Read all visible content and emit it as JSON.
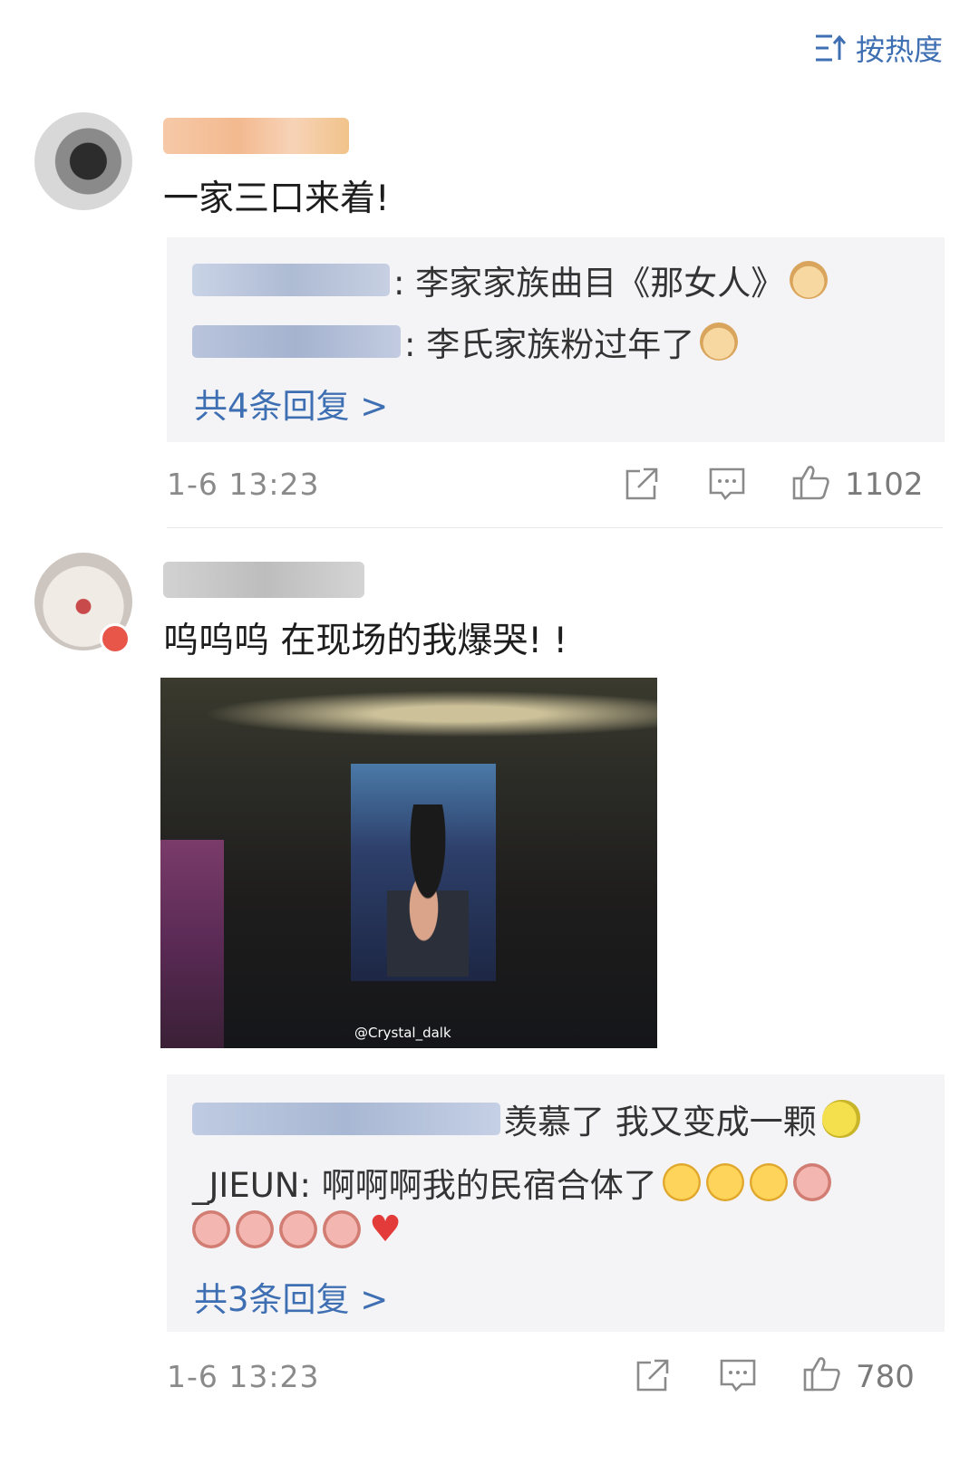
{
  "sort": {
    "label": "按热度"
  },
  "comments": [
    {
      "text": "一家三口来着!",
      "replies": [
        {
          "text": ": 李家家族曲目《那女人》",
          "emojis": [
            "doge"
          ]
        },
        {
          "text": ": 李氏家族粉过年了",
          "emojis": [
            "doge"
          ]
        }
      ],
      "more": "共4条回复 >",
      "time": "1-6 13:23",
      "likes": "1102"
    },
    {
      "text": "呜呜呜 在现场的我爆哭! !",
      "image_watermark": "@Crystal_dalk",
      "replies": [
        {
          "text": "羡慕了 我又变成一颗",
          "emojis": [
            "lemon"
          ]
        },
        {
          "text": "_JIEUN: 啊啊啊我的民宿合体了",
          "emojis": [
            "cry",
            "cry",
            "cry",
            "pig"
          ]
        },
        {
          "text": "",
          "emojis": [
            "pig",
            "pig",
            "pig",
            "pig",
            "heart"
          ]
        }
      ],
      "more": "共3条回复 >",
      "time": "1-6 13:23",
      "likes": "780"
    }
  ],
  "colors": {
    "link": "#3f6fb3",
    "meta": "#8a8a8a",
    "reply_bg": "#f4f4f6"
  }
}
